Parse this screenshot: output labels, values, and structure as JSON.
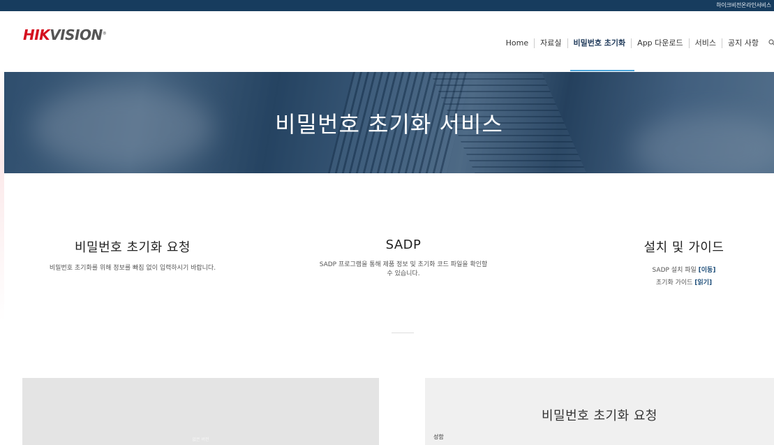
{
  "topbar": {
    "util_text": "하이크비전온라인서비스"
  },
  "logo": {
    "hik": "HIK",
    "vision": "VISION",
    "reg": "®"
  },
  "nav": {
    "items": [
      {
        "label": "Home"
      },
      {
        "label": "자료실"
      },
      {
        "label": "비밀번호 초기화",
        "active": true
      },
      {
        "label": "App 다운로드"
      },
      {
        "label": "서비스"
      },
      {
        "label": "공지 사항"
      }
    ],
    "search_icon": "search-icon"
  },
  "banner": {
    "title": "비밀번호 초기화 서비스"
  },
  "sections": {
    "reset": {
      "title": "비밀번호 초기화 요청",
      "desc": "비밀번호 초기화를 위해 정보를 빠짐 없이 입력하시기 바랍니다."
    },
    "sadp": {
      "title": "SADP",
      "desc_line1": "SADP 프로그램을 통해 제품 정보 및 초기화 코드 파일을 확인할",
      "desc_line2": "수 있습니다."
    },
    "guide": {
      "title": "설치 및 가이드",
      "line1_text": "SADP 설치 파일 ",
      "line1_link": "[이동]",
      "line2_text": "초기화 가이드 ",
      "line2_link": "[읽기]"
    }
  },
  "panels": {
    "left_caption": "없은 버전",
    "right_title": "비밀번호 초기화 요청",
    "right_field_label": "성함"
  },
  "colors": {
    "topbar": "#173c5e",
    "brand_red": "#d5101f",
    "accent_blue": "#4aa3d8"
  }
}
